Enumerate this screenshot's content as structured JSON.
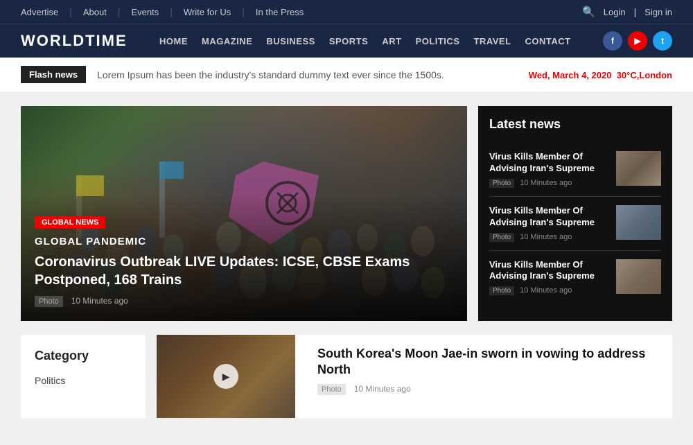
{
  "topbar": {
    "links": [
      "Advertise",
      "About",
      "Events",
      "Write for Us",
      "In the Press"
    ],
    "right": [
      "Login",
      "Sign in"
    ]
  },
  "nav": {
    "logo": "WORLDTIME",
    "links": [
      "HOME",
      "MAGAZINE",
      "BUSINESS",
      "SPORTS",
      "ART",
      "POLITICS",
      "TRAVEL",
      "CONTACT"
    ],
    "social": [
      "f",
      "▶",
      "t"
    ]
  },
  "flashbar": {
    "badge": "Flash news",
    "text": "Lorem Ipsum has been the industry's standard dummy text ever since the 1500s.",
    "date": "Wed, March 4, 2020",
    "temp": "30°C,London"
  },
  "hero": {
    "category": "global news",
    "title": "GLOBAL PANDEMIC",
    "subtitle": "Coronavirus Outbreak LIVE Updates: ICSE, CBSE Exams Postponed, 168 Trains",
    "meta_photo": "Photo",
    "meta_time": "10 Minutes ago"
  },
  "latest": {
    "title": "Latest news",
    "items": [
      {
        "title": "Virus Kills Member Of Advising Iran's Supreme",
        "photo": "Photo",
        "time": "10 Minutes ago"
      },
      {
        "title": "Virus Kills Member Of Advising Iran's Supreme",
        "photo": "Photo",
        "time": "10 Minutes ago"
      },
      {
        "title": "Virus Kills Member Of Advising Iran's Supreme",
        "photo": "Photo",
        "time": "10 Minutes ago"
      }
    ]
  },
  "category": {
    "title": "Category",
    "items": [
      "Politics"
    ]
  },
  "article": {
    "title": "South Korea's Moon Jae-in sworn in vowing to address North",
    "photo": "Photo",
    "time": "10 Minutes ago"
  }
}
